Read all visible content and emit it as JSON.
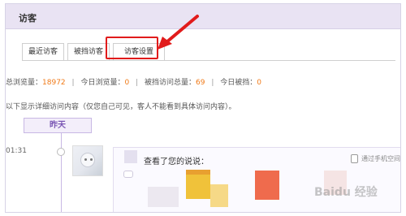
{
  "header": {
    "title": "访客"
  },
  "tabs": [
    {
      "label": "最近访客"
    },
    {
      "label": "被挡访客"
    },
    {
      "label": "访客设置"
    }
  ],
  "stats": {
    "total_label": "总浏览量：",
    "total_value": "18972",
    "today_label": "今日浏览量：",
    "today_value": "0",
    "blocked_total_label": "被挡访问总量：",
    "blocked_total_value": "69",
    "today_blocked_label": "今日被挡：",
    "today_blocked_value": "0",
    "separator": "|"
  },
  "notice": "以下显示详细访问内容（仅您自己可见，客人不能看到具体访问内容）。",
  "timeline": {
    "day_label": "昨天",
    "time": "01:31"
  },
  "visit": {
    "action_text": "查看了您的说说：",
    "via_text": "通过手机空间"
  },
  "watermark": "Baidu 经验",
  "colors": {
    "header_bg": "#e9e3f3",
    "accent_orange": "#f07a18",
    "highlight_red": "#e11b1b",
    "day_purple": "#7a56b4"
  }
}
